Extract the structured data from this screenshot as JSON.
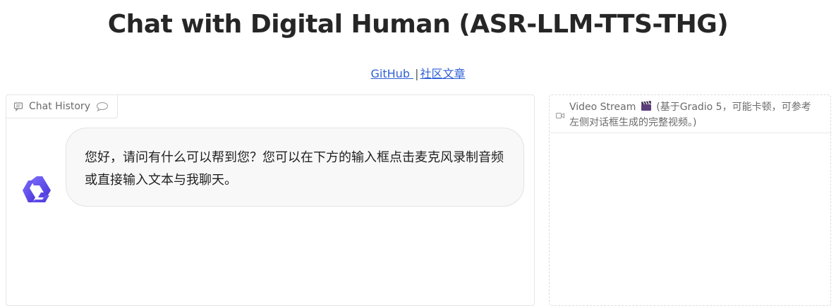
{
  "page": {
    "title": "Chat with Digital Human (ASR-LLM-TTS-THG)",
    "links": [
      {
        "label": "GitHub "
      },
      {
        "label": "社区文章"
      }
    ],
    "link_separator": "|"
  },
  "chat": {
    "label": "Chat History",
    "messages": [
      {
        "role": "assistant",
        "avatar_icon": "qwen-logo-icon",
        "text": "您好，请问有什么可以帮到您？您可以在下方的输入框点击麦克风录制音频或直接输入文本与我聊天。"
      }
    ]
  },
  "video": {
    "label": "Video Stream",
    "note": "(基于Gradio 5，可能卡顿，可参考左侧对话框生成的完整视频。)",
    "icons": [
      "video-camera-icon",
      "clapper-board-icon"
    ]
  },
  "colors": {
    "link": "#2f5fd6",
    "avatar_gradient_start": "#6a5cf6",
    "avatar_gradient_end": "#4f3fd8",
    "bubble_bg": "#f8f8f8"
  }
}
